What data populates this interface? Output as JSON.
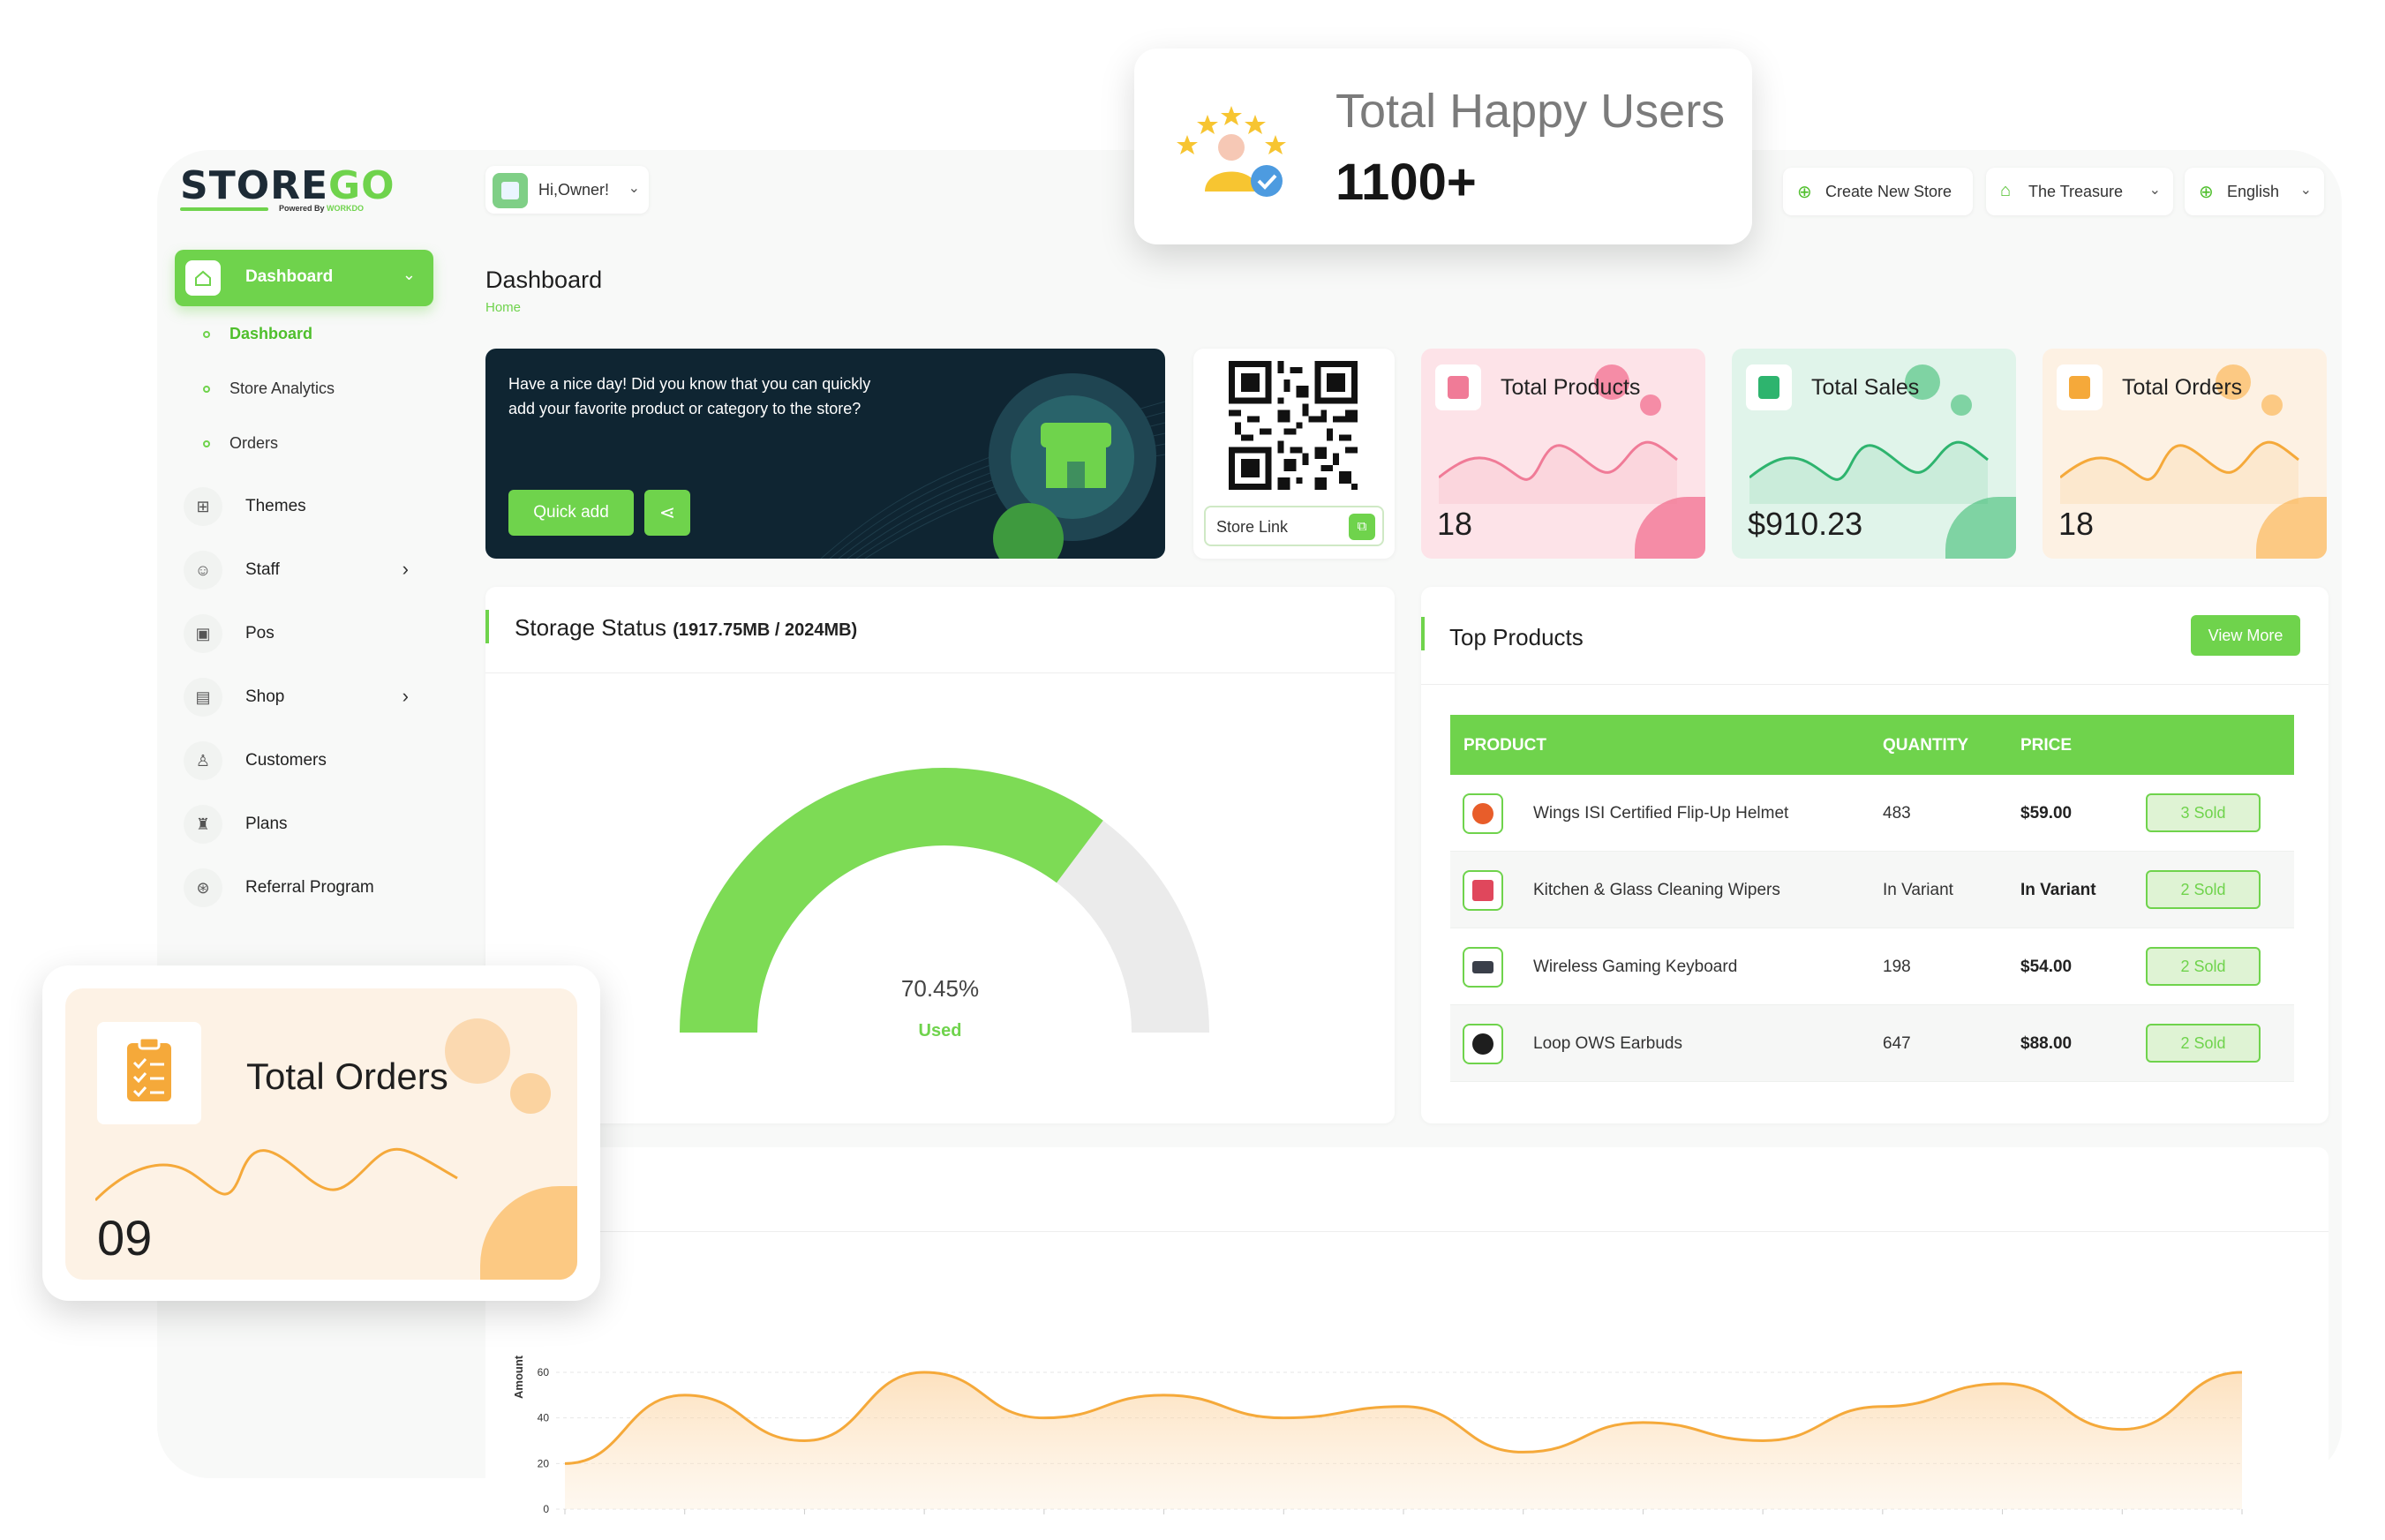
{
  "logo": {
    "brand_a": "STORE",
    "brand_b": "GO",
    "powered": "Powered By",
    "powered_brand": "WORKDO"
  },
  "sidebar": {
    "main": {
      "label": "Dashboard"
    },
    "sub_items": [
      {
        "label": "Dashboard"
      },
      {
        "label": "Store Analytics"
      },
      {
        "label": "Orders"
      }
    ],
    "items": [
      {
        "label": "Themes",
        "icon": "grid-icon"
      },
      {
        "label": "Staff",
        "icon": "users-icon"
      },
      {
        "label": "Pos",
        "icon": "pos-icon"
      },
      {
        "label": "Shop",
        "icon": "shop-icon"
      },
      {
        "label": "Customers",
        "icon": "user-icon"
      },
      {
        "label": "Plans",
        "icon": "trophy-icon"
      },
      {
        "label": "Referral Program",
        "icon": "referral-icon"
      }
    ]
  },
  "header": {
    "greeting": "Hi,Owner!",
    "create_store": "Create New Store",
    "store_name": "The Treasure",
    "language": "English",
    "page_title": "Dashboard",
    "breadcrumb": "Home"
  },
  "banner": {
    "text": "Have a nice day! Did you know that you can quickly add your favorite product or category to the store?",
    "quick_add": "Quick add"
  },
  "qr": {
    "store_link": "Store Link"
  },
  "stats": [
    {
      "title": "Total Products",
      "value": "18",
      "color": "#fde3e8",
      "accent": "#f58ca6",
      "line": "#f07b97"
    },
    {
      "title": "Total Sales",
      "value": "$910.23",
      "color": "#e0f4ea",
      "accent": "#7fd3a3",
      "line": "#2eb46e"
    },
    {
      "title": "Total Orders",
      "value": "18",
      "color": "#fdf1e3",
      "accent": "#fcc983",
      "line": "#f5a93a"
    }
  ],
  "storage": {
    "title": "Storage Status",
    "detail": "(1917.75MB / 2024MB)",
    "percent": 70.45,
    "percent_label": "70.45%",
    "used_label": "Used"
  },
  "top_products": {
    "title": "Top Products",
    "view_more": "View More",
    "columns": [
      "PRODUCT",
      "QUANTITY",
      "PRICE"
    ],
    "rows": [
      {
        "name": "Wings ISI Certified Flip-Up Helmet",
        "quantity": "483",
        "price": "$59.00",
        "sold": "3 Sold"
      },
      {
        "name": "Kitchen & Glass Cleaning Wipers",
        "quantity": "In Variant",
        "price": "In Variant",
        "sold": "2 Sold"
      },
      {
        "name": "Wireless Gaming Keyboard",
        "quantity": "198",
        "price": "$54.00",
        "sold": "2 Sold"
      },
      {
        "name": "Loop OWS Earbuds",
        "quantity": "647",
        "price": "$88.00",
        "sold": "2 Sold"
      }
    ]
  },
  "chart_data": {
    "type": "area",
    "ylabel": "Amount",
    "ylim": [
      0,
      60
    ],
    "yticks": [
      "0",
      "20",
      "40",
      "60"
    ],
    "values": [
      20,
      50,
      30,
      60,
      40,
      50,
      40,
      45,
      25,
      38,
      30,
      45,
      55,
      35,
      60
    ],
    "color": "#f5a93a"
  },
  "happy_users": {
    "label": "Total Happy Users",
    "value": "1100+"
  },
  "orders_float": {
    "title": "Total Orders",
    "value": "09"
  },
  "colors": {
    "accent": "#6fd34c",
    "banner": "#0f2532"
  }
}
